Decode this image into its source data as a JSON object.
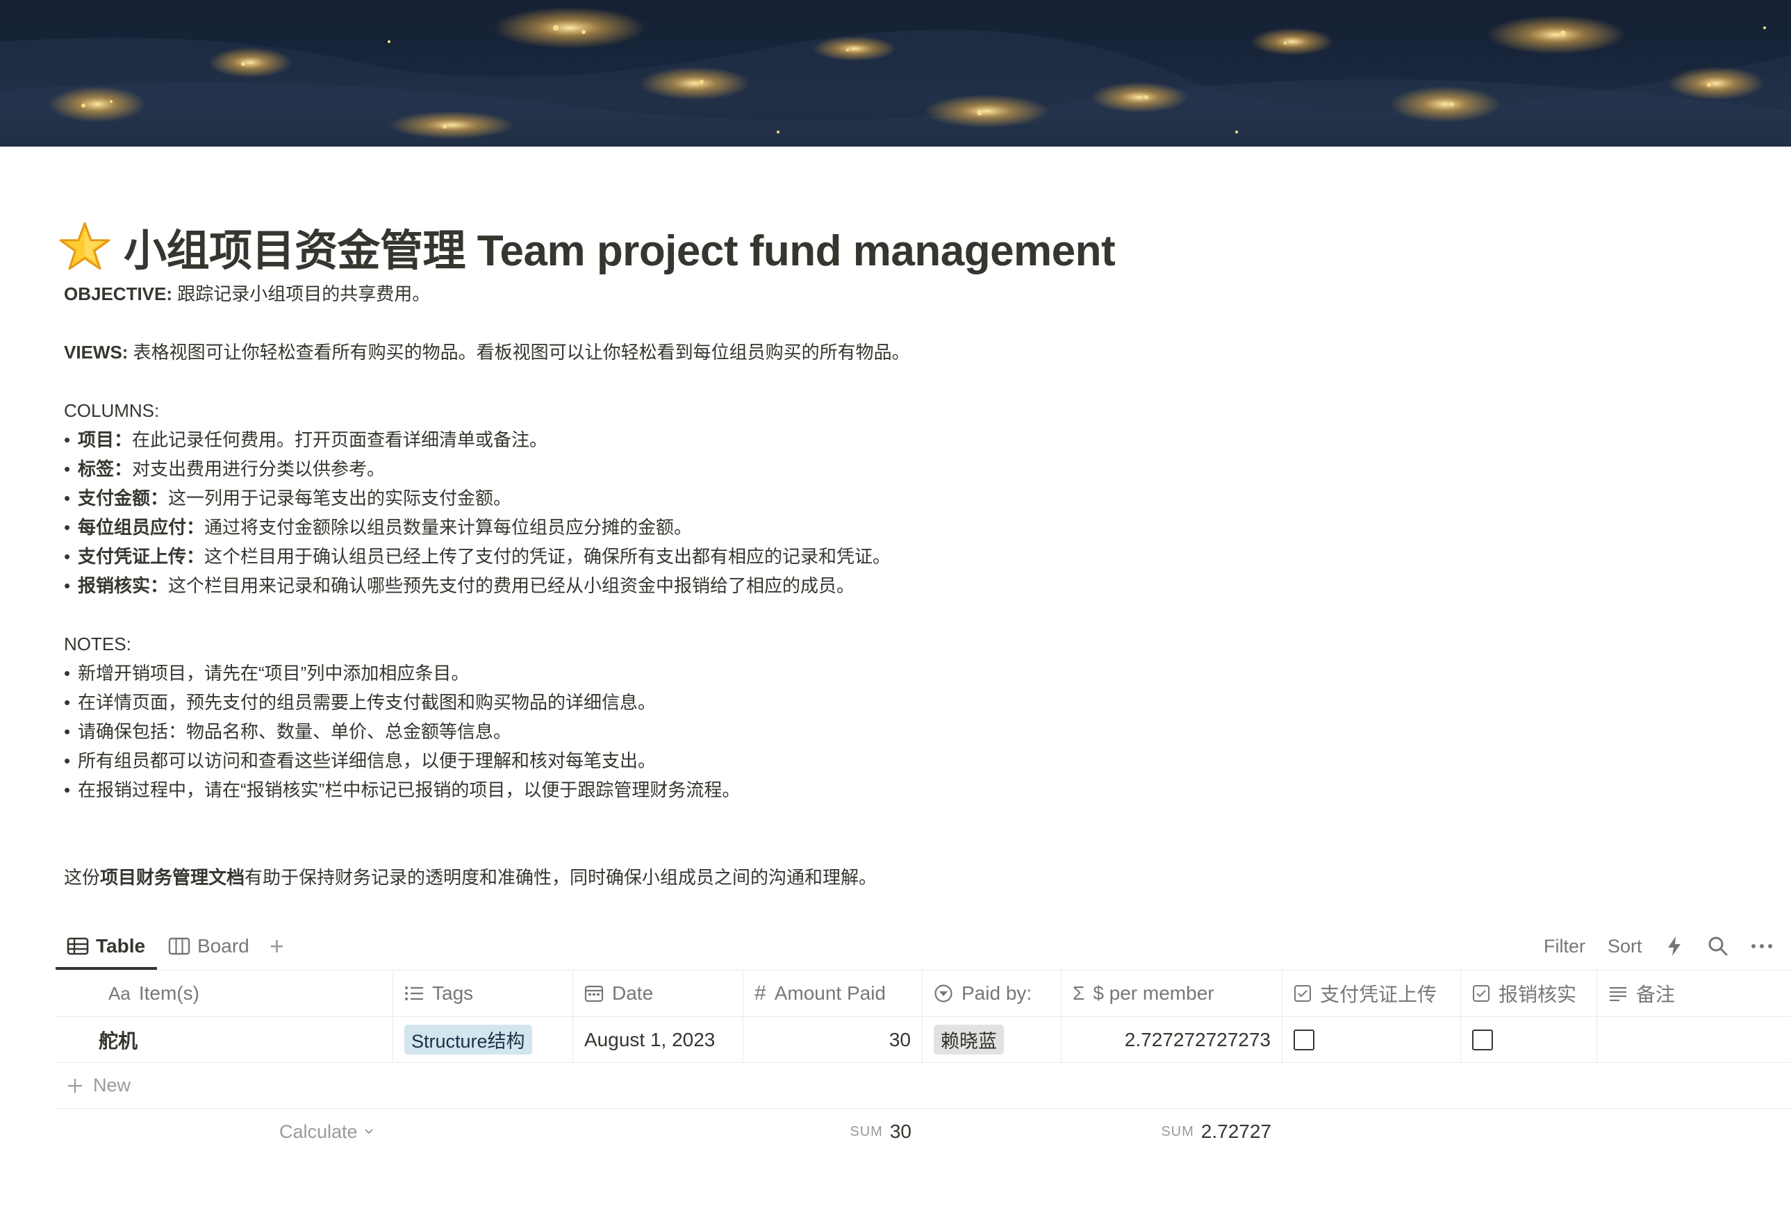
{
  "page": {
    "title": "小组项目资金管理 Team project fund management",
    "icon": "star-emoji"
  },
  "content": {
    "objective_label": "OBJECTIVE:",
    "objective_text": " 跟踪记录小组项目的共享费用。",
    "views_label": "VIEWS:",
    "views_text": " 表格视图可让你轻松查看所有购买的物品。看板视图可以让你轻松看到每位组员购买的所有物品。",
    "columns_label": "COLUMNS:",
    "columns": [
      {
        "bullet": "•",
        "name": "项目：",
        "desc": "在此记录任何费用。打开页面查看详细清单或备注。"
      },
      {
        "bullet": "•",
        "name": "标签：",
        "desc": "对支出费用进行分类以供参考。"
      },
      {
        "bullet": "•",
        "name": "支付金额：",
        "desc": "这一列用于记录每笔支出的实际支付金额。"
      },
      {
        "bullet": "•",
        "name": "每位组员应付：",
        "desc": "通过将支付金额除以组员数量来计算每位组员应分摊的金额。"
      },
      {
        "bullet": "•",
        "name": "支付凭证上传：",
        "desc": "这个栏目用于确认组员已经上传了支付的凭证，确保所有支出都有相应的记录和凭证。"
      },
      {
        "bullet": "•",
        "name": "报销核实：",
        "desc": "这个栏目用来记录和确认哪些预先支付的费用已经从小组资金中报销给了相应的成员。"
      }
    ],
    "notes_label": "NOTES:",
    "notes": [
      {
        "bullet": "•",
        "text": "新增开销项目，请先在“项目”列中添加相应条目。"
      },
      {
        "bullet": "•",
        "text": "在详情页面，预先支付的组员需要上传支付截图和购买物品的详细信息。"
      },
      {
        "bullet": "•",
        "text": "请确保包括：物品名称、数量、单价、总金额等信息。"
      },
      {
        "bullet": "•",
        "text": "所有组员都可以访问和查看这些详细信息，以便于理解和核对每笔支出。"
      },
      {
        "bullet": "•",
        "text": "在报销过程中，请在“报销核实”栏中标记已报销的项目，以便于跟踪管理财务流程。"
      }
    ],
    "summary_pre": "这份",
    "summary_bold": "项目财务管理文档",
    "summary_post": "有助于保持财务记录的透明度和准确性，同时确保小组成员之间的沟通和理解。"
  },
  "views": {
    "tabs": [
      {
        "label": "Table",
        "icon": "table-icon",
        "active": true
      },
      {
        "label": "Board",
        "icon": "board-icon",
        "active": false
      }
    ],
    "add_icon": "+",
    "toolbar": {
      "filter": "Filter",
      "sort": "Sort"
    }
  },
  "table": {
    "columns": [
      {
        "label": "Item(s)",
        "icon": "Aa"
      },
      {
        "label": "Tags",
        "icon": "list-icon"
      },
      {
        "label": "Date",
        "icon": "calendar-icon"
      },
      {
        "label": "Amount Paid",
        "icon": "#"
      },
      {
        "label": "Paid by:",
        "icon": "select-icon"
      },
      {
        "label": "$ per member",
        "icon": "Σ"
      },
      {
        "label": "支付凭证上传",
        "icon": "checkbox-icon"
      },
      {
        "label": "报销核实",
        "icon": "checkbox-icon"
      },
      {
        "label": "备注",
        "icon": "text-icon"
      }
    ],
    "rows": [
      {
        "item": "舵机",
        "tag": "Structure结构",
        "date": "August 1, 2023",
        "amount": "30",
        "paid_by": "赖晓蓝",
        "per_member": "2.727272727273",
        "receipt_uploaded": false,
        "reimbursed": false,
        "notes": ""
      }
    ],
    "new_label": "New",
    "calculate_label": "Calculate",
    "sums": [
      {
        "label": "SUM",
        "value": "30"
      },
      {
        "label": "SUM",
        "value": "2.72727"
      }
    ]
  },
  "colors": {
    "text": "#37352f",
    "muted": "#787774",
    "border": "#e9e9e7",
    "tag_blue_bg": "#d3e5ef",
    "tag_gray_bg": "#e3e2e0"
  }
}
